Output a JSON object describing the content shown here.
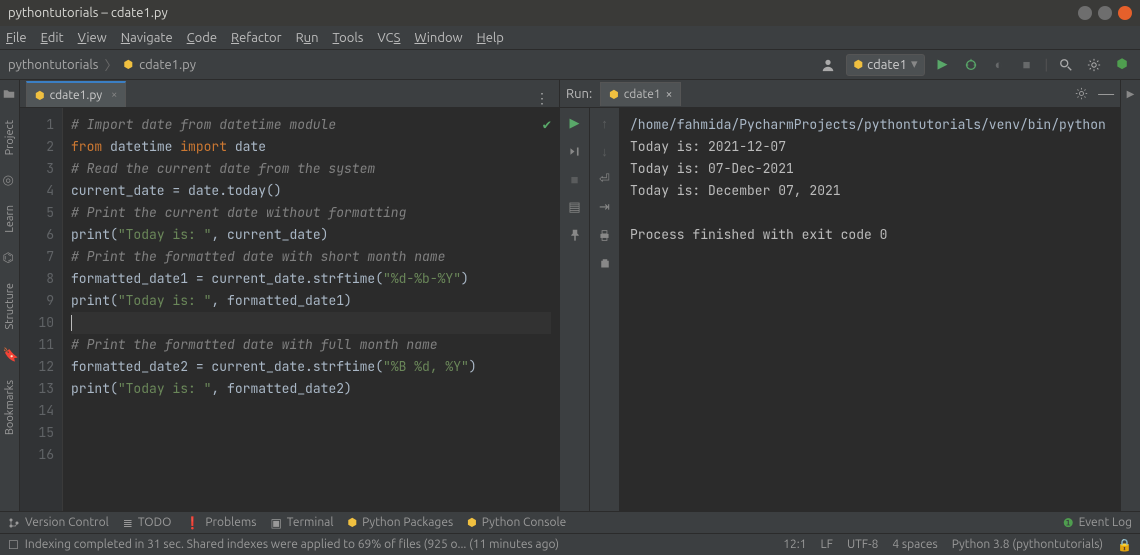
{
  "window": {
    "title": "pythontutorials – cdate1.py"
  },
  "menubar": [
    "File",
    "Edit",
    "View",
    "Navigate",
    "Code",
    "Refactor",
    "Run",
    "Tools",
    "VCS",
    "Window",
    "Help"
  ],
  "breadcrumb": {
    "project": "pythontutorials",
    "file": "cdate1.py"
  },
  "runconfig": {
    "name": "cdate1"
  },
  "editor": {
    "tab": {
      "label": "cdate1.py"
    },
    "lines": [
      {
        "n": 1,
        "tokens": [
          {
            "t": "# Import date from datetime module",
            "c": "cm"
          }
        ]
      },
      {
        "n": 2,
        "tokens": [
          {
            "t": "from ",
            "c": "kw"
          },
          {
            "t": "datetime ",
            "c": "id"
          },
          {
            "t": "import ",
            "c": "kw"
          },
          {
            "t": "date",
            "c": "id"
          }
        ]
      },
      {
        "n": 3,
        "tokens": [
          {
            "t": "",
            "c": "id"
          }
        ]
      },
      {
        "n": 4,
        "tokens": [
          {
            "t": "# Read the current date from the system",
            "c": "cm"
          }
        ]
      },
      {
        "n": 5,
        "tokens": [
          {
            "t": "current_date ",
            "c": "id"
          },
          {
            "t": "= ",
            "c": "op"
          },
          {
            "t": "date.today()",
            "c": "id"
          }
        ]
      },
      {
        "n": 6,
        "tokens": [
          {
            "t": "# Print the current date without formatting",
            "c": "cm"
          }
        ]
      },
      {
        "n": 7,
        "tokens": [
          {
            "t": "print",
            "c": "id"
          },
          {
            "t": "(",
            "c": "op"
          },
          {
            "t": "\"Today is: \"",
            "c": "str"
          },
          {
            "t": ", current_date)",
            "c": "id"
          }
        ]
      },
      {
        "n": 8,
        "tokens": [
          {
            "t": "",
            "c": "id"
          }
        ]
      },
      {
        "n": 9,
        "tokens": [
          {
            "t": "# Print the formatted date with short month name",
            "c": "cm"
          }
        ]
      },
      {
        "n": 10,
        "tokens": [
          {
            "t": "formatted_date1 ",
            "c": "id"
          },
          {
            "t": "= ",
            "c": "op"
          },
          {
            "t": "current_date.strftime(",
            "c": "id"
          },
          {
            "t": "\"%d-%b-%Y\"",
            "c": "str"
          },
          {
            "t": ")",
            "c": "id"
          }
        ]
      },
      {
        "n": 11,
        "tokens": [
          {
            "t": "print",
            "c": "id"
          },
          {
            "t": "(",
            "c": "op"
          },
          {
            "t": "\"Today is: \"",
            "c": "str"
          },
          {
            "t": ", formatted_date1)",
            "c": "id"
          }
        ]
      },
      {
        "n": 12,
        "tokens": [
          {
            "t": "",
            "c": "id"
          }
        ],
        "current": true
      },
      {
        "n": 13,
        "tokens": [
          {
            "t": "# Print the formatted date with full month name",
            "c": "cm"
          }
        ]
      },
      {
        "n": 14,
        "tokens": [
          {
            "t": "formatted_date2 ",
            "c": "id"
          },
          {
            "t": "= ",
            "c": "op"
          },
          {
            "t": "current_date.strftime(",
            "c": "id"
          },
          {
            "t": "\"%B %d, %Y\"",
            "c": "str"
          },
          {
            "t": ")",
            "c": "id"
          }
        ]
      },
      {
        "n": 15,
        "tokens": [
          {
            "t": "print",
            "c": "id"
          },
          {
            "t": "(",
            "c": "op"
          },
          {
            "t": "\"Today is: \"",
            "c": "str"
          },
          {
            "t": ", formatted_date2)",
            "c": "id"
          }
        ]
      },
      {
        "n": 16,
        "tokens": [
          {
            "t": "",
            "c": "id"
          }
        ]
      }
    ]
  },
  "run": {
    "panel_label": "Run:",
    "tab": "cdate1",
    "output": [
      "/home/fahmida/PycharmProjects/pythontutorials/venv/bin/python",
      "Today is:  2021-12-07",
      "Today is:  07-Dec-2021",
      "Today is:  December 07, 2021",
      "",
      "Process finished with exit code 0"
    ]
  },
  "left_ribbon": [
    "Project",
    "Learn",
    "Structure",
    "Bookmarks"
  ],
  "bottom_tools": [
    "Version Control",
    "TODO",
    "Problems",
    "Terminal",
    "Python Packages",
    "Python Console"
  ],
  "event_log": "Event Log",
  "status": {
    "message": "Indexing completed in 31 sec. Shared indexes were applied to 69% of files (925 o... (11 minutes ago)",
    "caret": "12:1",
    "linesep": "LF",
    "encoding": "UTF-8",
    "indent": "4 spaces",
    "interpreter": "Python 3.8 (pythontutorials)"
  }
}
